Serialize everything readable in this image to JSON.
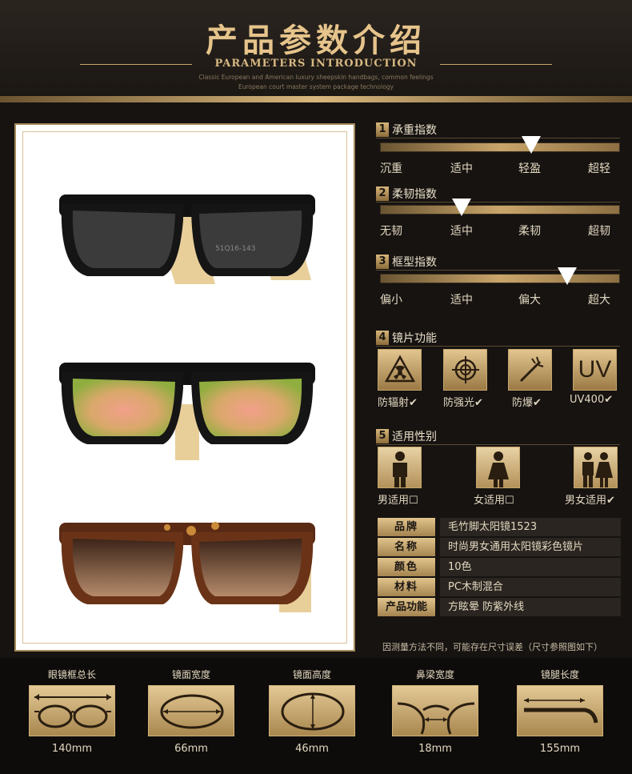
{
  "header": {
    "title_cn": "产品参数介绍",
    "title_en": "PARAMETERS INTRODUCTION",
    "sub1": "Classic European and American luxury sheepskin handbags, common feelings",
    "sub2": "European court master system package technology"
  },
  "sections": {
    "s1": {
      "num": "1",
      "title": "承重指数",
      "scale": [
        "沉重",
        "适中",
        "轻盈",
        "超轻"
      ],
      "level": 0.63
    },
    "s2": {
      "num": "2",
      "title": "柔韧指数",
      "scale": [
        "无韧",
        "适中",
        "柔韧",
        "超韧"
      ],
      "level": 0.34
    },
    "s3": {
      "num": "3",
      "title": "框型指数",
      "scale": [
        "偏小",
        "适中",
        "偏大",
        "超大"
      ],
      "level": 0.78
    },
    "s4": {
      "num": "4",
      "title": "镜片功能",
      "items": [
        {
          "label": "防辐射✔",
          "icon": "radiation-icon"
        },
        {
          "label": "防强光✔",
          "icon": "crosshair-icon"
        },
        {
          "label": "防爆✔",
          "icon": "impact-icon"
        },
        {
          "label": "UV400✔",
          "icon": "uv-icon",
          "text": "UV"
        }
      ]
    },
    "s5": {
      "num": "5",
      "title": "适用性别",
      "items": [
        {
          "label": "男适用☐",
          "icon": "male-icon"
        },
        {
          "label": "女适用☐",
          "icon": "female-icon"
        },
        {
          "label": "男女适用✔",
          "icon": "unisex-icon"
        }
      ]
    }
  },
  "specs": [
    {
      "key": "品牌",
      "value": "毛竹脚太阳镜1523"
    },
    {
      "key": "名称",
      "value": "时尚男女通用太阳镜彩色镜片"
    },
    {
      "key": "颜色",
      "value": "10色"
    },
    {
      "key": "材料",
      "value": "PC木制混合"
    },
    {
      "key": "产品功能",
      "value": "方眩晕 防紫外线"
    }
  ],
  "note": "因测量方法不同，可能存在尺寸误差（尺寸参照图如下）",
  "measures": [
    {
      "title": "眼镜框总长",
      "value": "140mm",
      "icon": "frame-length-icon"
    },
    {
      "title": "镜面宽度",
      "value": "66mm",
      "icon": "lens-width-icon"
    },
    {
      "title": "镜面高度",
      "value": "46mm",
      "icon": "lens-height-icon"
    },
    {
      "title": "鼻梁宽度",
      "value": "18mm",
      "icon": "bridge-width-icon"
    },
    {
      "title": "镜腿长度",
      "value": "155mm",
      "icon": "temple-length-icon"
    }
  ],
  "photo_text": "51Q16-143"
}
